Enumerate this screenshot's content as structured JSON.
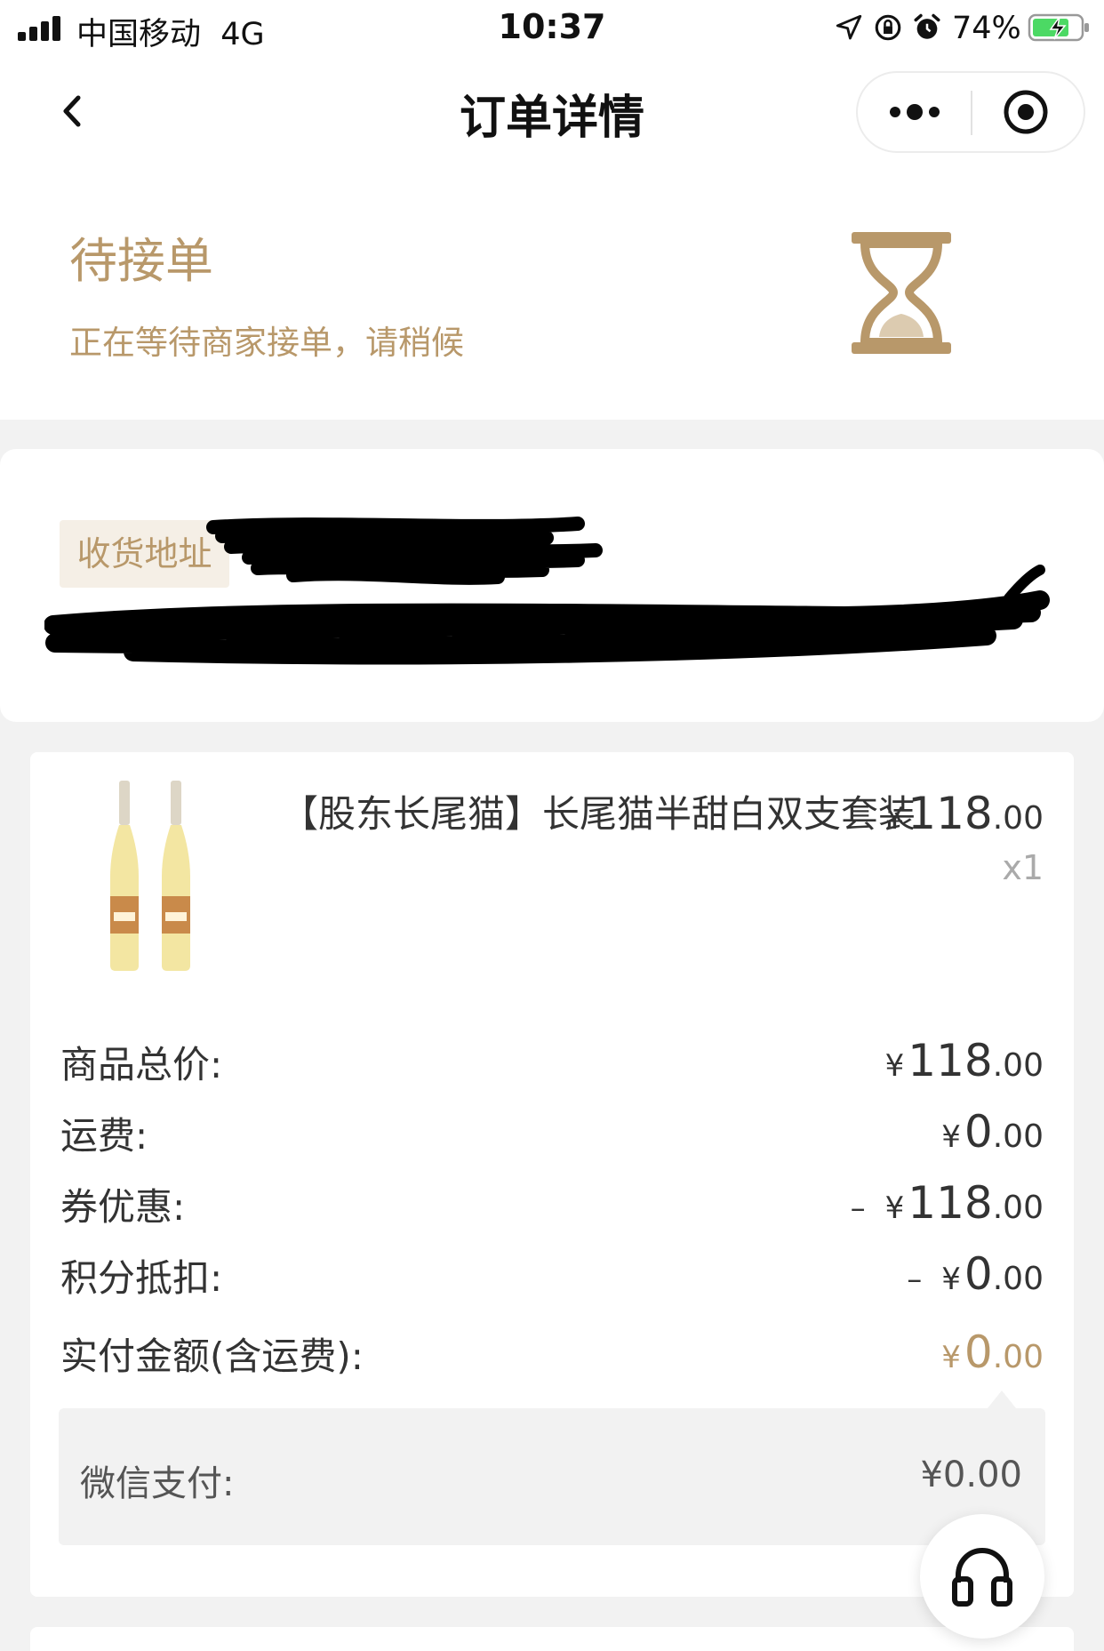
{
  "status_bar": {
    "carrier": "中国移动",
    "network": "4G",
    "time": "10:37",
    "battery": "74%"
  },
  "nav": {
    "title": "订单详情",
    "back_icon": "chevron-left-icon",
    "more_icon": "more-dots-icon",
    "close_icon": "target-close-icon"
  },
  "order_status": {
    "title": "待接单",
    "description": "正在等待商家接单，请稍候",
    "icon": "hourglass-icon",
    "accent_color": "#b8986a"
  },
  "address": {
    "tag": "收货地址"
  },
  "product": {
    "name": "【股东长尾猫】长尾猫半甜白双支套装",
    "currency": "¥",
    "price_int": "118",
    "price_dec": ".00",
    "quantity": "x1"
  },
  "summary": {
    "goods_total": {
      "label": "商品总价:",
      "currency": "¥",
      "int": "118",
      "dec": ".00"
    },
    "shipping": {
      "label": "运费:",
      "currency": "¥",
      "int": "0",
      "dec": ".00"
    },
    "coupon": {
      "label": "券优惠:",
      "minus": "–",
      "currency": "¥",
      "int": "118",
      "dec": ".00"
    },
    "points": {
      "label": "积分抵扣:",
      "minus": "–",
      "currency": "¥",
      "int": "0",
      "dec": ".00"
    },
    "paid": {
      "label": "实付金额(含运费):",
      "currency": "¥",
      "int": "0",
      "dec": ".00"
    }
  },
  "payment": {
    "label": "微信支付:",
    "value": "¥0.00"
  },
  "support": {
    "icon": "headset-icon"
  }
}
